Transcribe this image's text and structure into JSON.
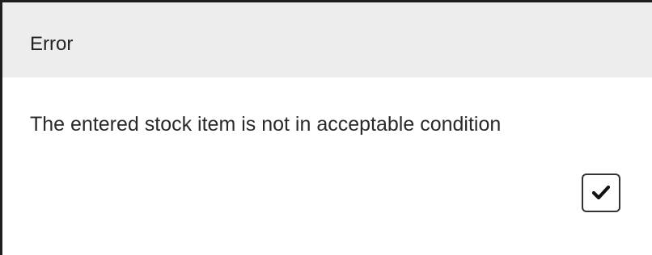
{
  "dialog": {
    "title": "Error",
    "message": "The entered stock item is not in acceptable condition",
    "confirm_icon": "checkmark-icon"
  }
}
